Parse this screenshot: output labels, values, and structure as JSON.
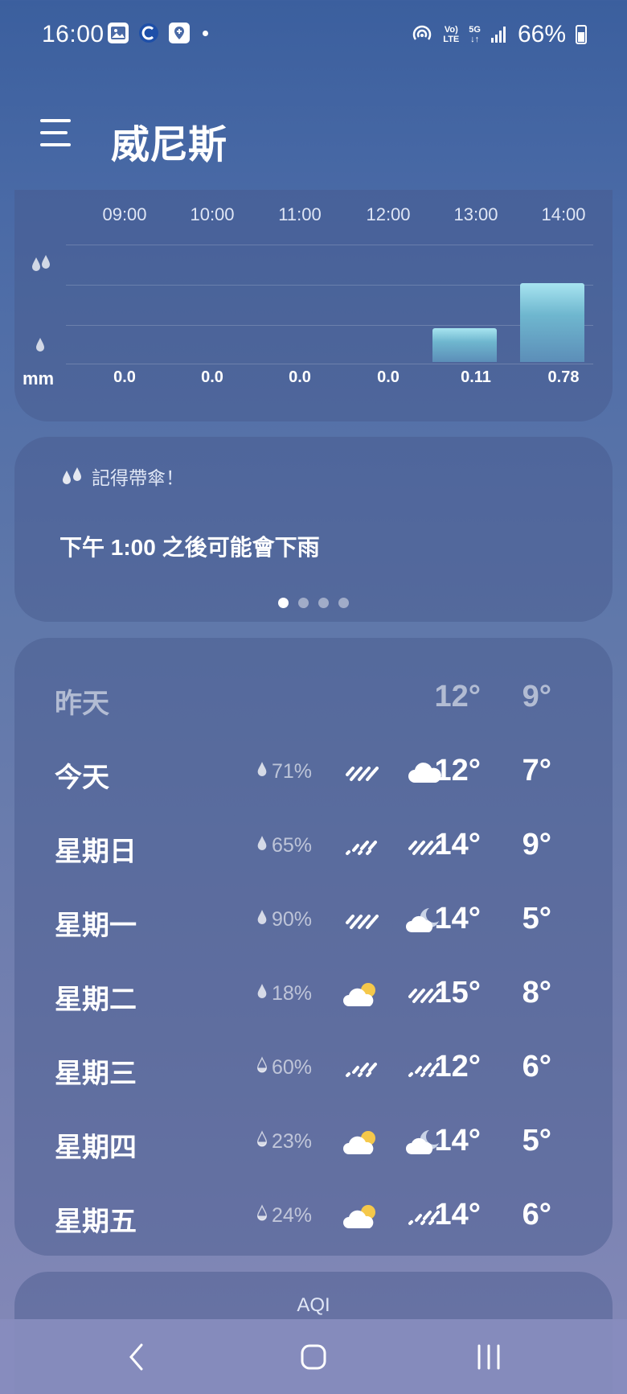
{
  "status_bar": {
    "time": "16:00",
    "battery": "66%",
    "network_top": "Vo)",
    "network_bottom": "LTE",
    "network_5g": "5G"
  },
  "header": {
    "title": "威尼斯"
  },
  "precipitation": {
    "hours": [
      "09:00",
      "10:00",
      "11:00",
      "12:00",
      "13:00",
      "14:00"
    ],
    "unit": "mm",
    "values": [
      "0.0",
      "0.0",
      "0.0",
      "0.0",
      "0.11",
      "0.78"
    ],
    "amounts": [
      0.0,
      0.0,
      0.0,
      0.0,
      0.11,
      0.78
    ]
  },
  "umbrella": {
    "title": "記得帶傘！",
    "message": "下午 1:00 之後可能會下雨",
    "page_count": 4,
    "active_page": 0
  },
  "forecast": {
    "yesterday": {
      "day": "昨天",
      "high": "12°",
      "low": "9°"
    },
    "days": [
      {
        "day": "今天",
        "pop": "71%",
        "day_icon": "rain-icon",
        "night_icon": "cloud-icon",
        "high": "12°",
        "low": "7°"
      },
      {
        "day": "星期日",
        "pop": "65%",
        "day_icon": "light-rain-icon",
        "night_icon": "rain-icon",
        "high": "14°",
        "low": "9°"
      },
      {
        "day": "星期一",
        "pop": "90%",
        "day_icon": "rain-icon",
        "night_icon": "cloudy-night-icon",
        "high": "14°",
        "low": "5°"
      },
      {
        "day": "星期二",
        "pop": "18%",
        "day_icon": "partly-cloudy-icon",
        "night_icon": "rain-icon",
        "high": "15°",
        "low": "8°"
      },
      {
        "day": "星期三",
        "pop": "60%",
        "day_icon": "light-rain-icon",
        "night_icon": "light-rain-icon",
        "high": "12°",
        "low": "6°"
      },
      {
        "day": "星期四",
        "pop": "23%",
        "day_icon": "partly-cloudy-icon",
        "night_icon": "cloudy-night-icon",
        "high": "14°",
        "low": "5°"
      },
      {
        "day": "星期五",
        "pop": "24%",
        "day_icon": "partly-cloudy-icon",
        "night_icon": "light-rain-icon",
        "high": "14°",
        "low": "6°"
      }
    ]
  },
  "aqi": {
    "label": "AQI"
  },
  "colors": {
    "bar": "#8fd3e6",
    "sun": "#f5c84a"
  }
}
